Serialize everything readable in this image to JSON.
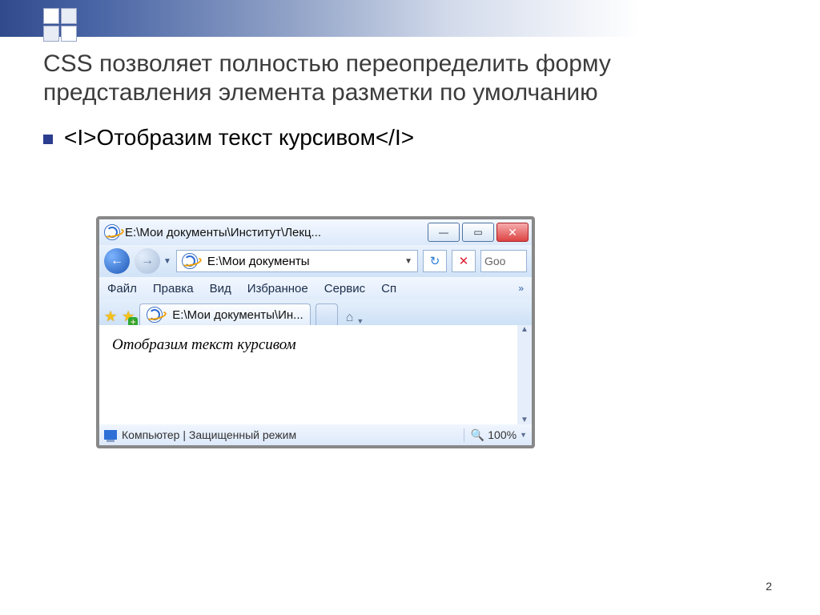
{
  "slide": {
    "title": "CSS позволяет полностью переопределить форму представления элемента разметки по умолчанию",
    "bullet1": "<I>Отобразим текст курсивом</I>",
    "page_number": "2"
  },
  "browser": {
    "window_title": "E:\\Мои документы\\Институт\\Лекц...",
    "address": "E:\\Мои документы",
    "search_hint": "Goo",
    "menu": {
      "file": "Файл",
      "edit": "Правка",
      "view": "Вид",
      "fav": "Избранное",
      "tools": "Сервис",
      "help": "Сп",
      "more": "»"
    },
    "tab_label": "E:\\Мои документы\\Ин...",
    "page_body": "Отобразим текст курсивом",
    "status_text": "Компьютер | Защищенный режим",
    "zoom": "100%"
  }
}
